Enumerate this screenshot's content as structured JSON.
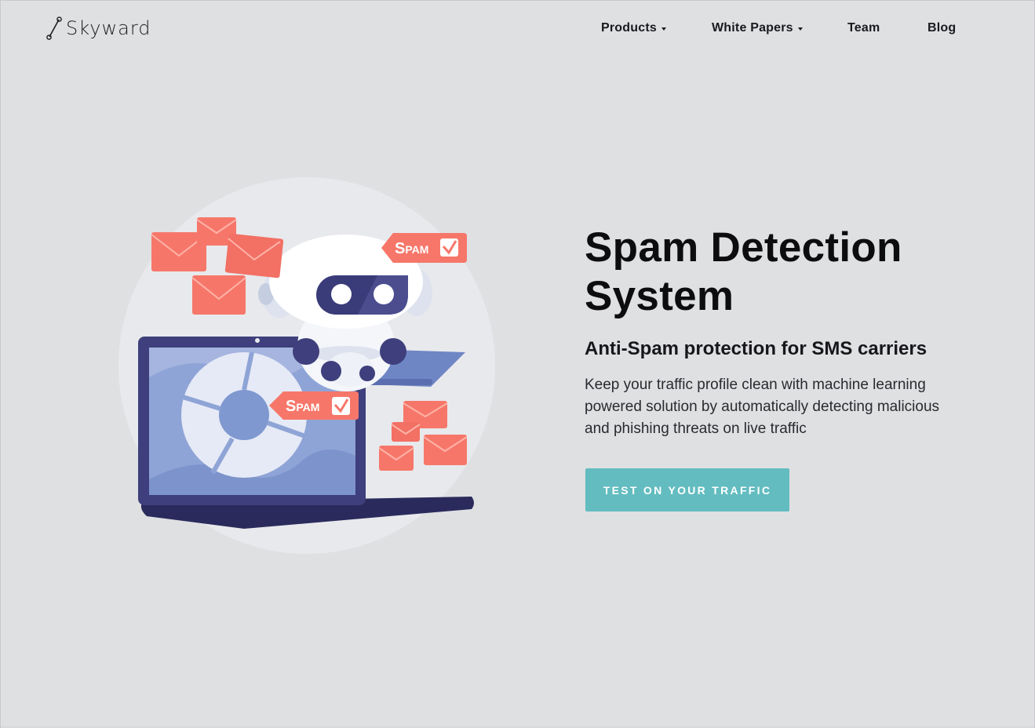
{
  "header": {
    "brand": "Skyward",
    "nav": [
      {
        "label": "Products",
        "dropdown": true
      },
      {
        "label": "White Papers",
        "dropdown": true
      },
      {
        "label": "Team",
        "dropdown": false
      },
      {
        "label": "Blog",
        "dropdown": false
      }
    ]
  },
  "illustration": {
    "badge_top": "Spam",
    "badge_middle": "Spam"
  },
  "hero": {
    "title_line1": "Spam Detection",
    "title_line2": "System",
    "subtitle": "Anti-Spam protection for SMS carriers",
    "description": "Keep your traffic profile clean with machine learning powered solution by automatically detecting malicious and phishing threats on live traffic",
    "cta_label": "TEST ON YOUR TRAFFIC"
  },
  "colors": {
    "background": "#dfe0e2",
    "accent": "#63bcc0",
    "envelope": "#f6776a",
    "laptop": "#3e3f7c",
    "screen": "#8fa4d6"
  }
}
